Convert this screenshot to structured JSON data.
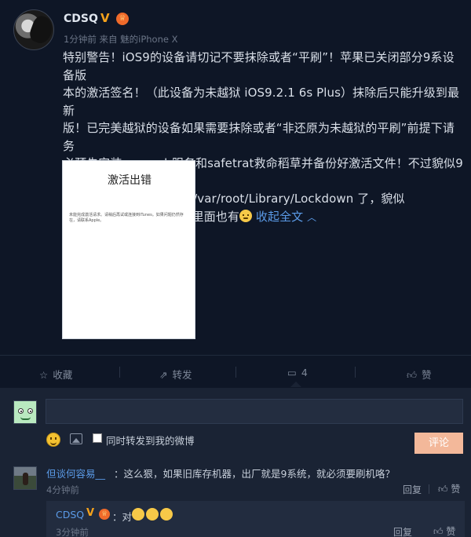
{
  "post": {
    "username": "CDSQ",
    "verified_badge": "V",
    "meta_time": "1分钟前",
    "meta_source_prefix": "来自",
    "meta_source": "魅的iPhone X",
    "content_line_1": "特别警告！iOS9的设备请切记不要抹除或者“平刷”！苹果已关闭部分9系设备版",
    "content_line_2": "本的激活签名！（此设备为未越狱 iOS9.2.1 6s Plus）抹除后只能升级到最新",
    "content_line_3": "版！已完美越狱的设备如果需要抹除或者“非还原为未越狱的平刷”前提下请务",
    "content_line_4": "必预先安装openssh服务和safetrat救命稻草并备份好激活文件！不过貌似9系统",
    "content_line_5": "的激活文件不光是以前的/var/root/Library/Lockdown 了，貌似",
    "content_line_6": "在/var/mobile/Library 里面也有",
    "collapse_label": "收起全文",
    "image": {
      "title": "激活出错",
      "body": "未能完成激活请求。请稍后再试或连接到iTunes。如果问题仍然存在，请联系Apple。"
    }
  },
  "actions": {
    "favorite_label": "收藏",
    "forward_label": "转发",
    "comment_count": "4",
    "like_label": "赞"
  },
  "composer": {
    "input_value": "",
    "checkbox_label": "同时转发到我的微博",
    "submit_label": "评论"
  },
  "comments": [
    {
      "user": "但谈何容易__",
      "text": "：这么狠，如果旧库存机器，出厂就是9系统，就必须要刷机咯？",
      "time": "4分钟前",
      "reply_label": "回复",
      "like_label": "赞"
    }
  ],
  "reply": {
    "user": "CDSQ",
    "text": "：对",
    "time": "3分钟前",
    "reply_label": "回复",
    "like_label": "赞"
  },
  "colors": {
    "background": "#0e1626",
    "panel": "#1a2334",
    "link": "#5b9be8",
    "verified": "#f4a21c",
    "submit": "#f3b89a"
  },
  "icons": [
    "star-icon",
    "forward-icon",
    "comment-icon",
    "thumbs-up-icon",
    "smile-icon",
    "picture-icon",
    "chevron-up-icon"
  ]
}
